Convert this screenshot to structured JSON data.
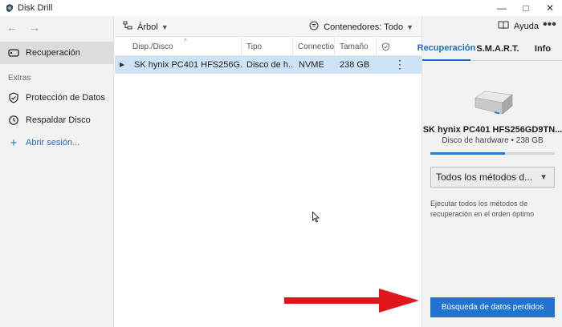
{
  "window": {
    "title": "Disk Drill",
    "minimize": "—",
    "maximize": "□",
    "close": "✕"
  },
  "sidebar": {
    "back": "←",
    "forward": "→",
    "items": [
      {
        "label": "Recuperación"
      },
      {
        "label": "Protección de Datos"
      },
      {
        "label": "Respaldar Disco"
      }
    ],
    "section_extras": "Extras",
    "login": "Abrir sesión..."
  },
  "toolbar": {
    "tree_label": "Árbol",
    "filter_label": "Contenedores: Todo"
  },
  "table": {
    "columns": [
      "Disp./Disco",
      "Tipo",
      "Connectio...",
      "Tamaño",
      ""
    ],
    "rows": [
      {
        "name": "SK hynix PC401 HFS256G...",
        "type": "Disco de h...",
        "connection": "NVME",
        "size": "238 GB"
      }
    ]
  },
  "right_panel": {
    "help": "Ayuda",
    "more": "•••",
    "tabs": [
      {
        "label": "Recuperación"
      },
      {
        "label": "S.M.A.R.T."
      },
      {
        "label": "Info"
      }
    ],
    "disk_name": "SK hynix PC401 HFS256GD9TN...",
    "disk_sub": "Disco de hardware • 238 GB",
    "usage_fraction": 0.6,
    "method": "Todos los métodos d...",
    "description": "Ejecutar todos los métodos de recuperación en el orden óptimo",
    "search_button": "Búsqueda de datos perdidos"
  },
  "colors": {
    "accent": "#1f74d1",
    "selection": "#cfe3f7",
    "arrow": "#e0161b"
  }
}
